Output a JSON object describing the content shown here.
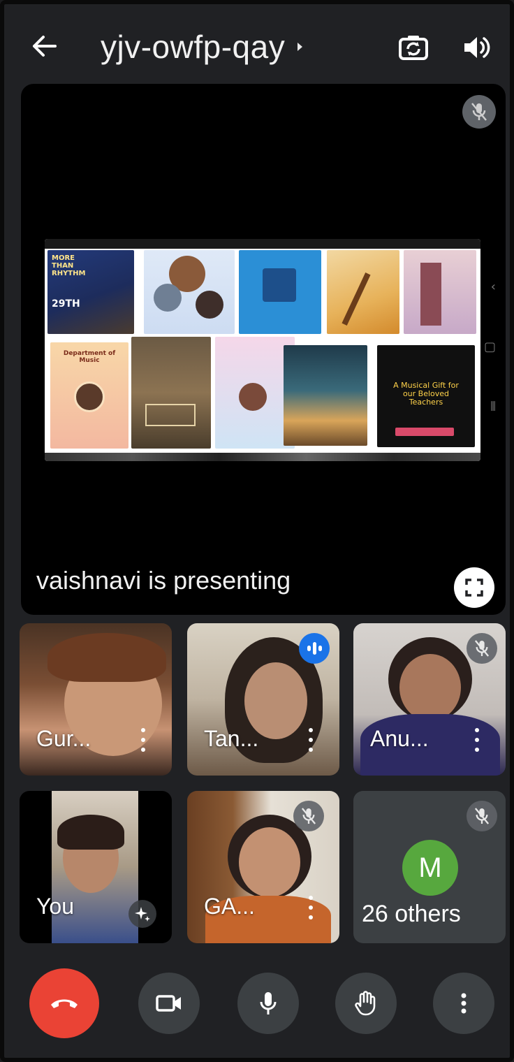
{
  "header": {
    "meeting_code": "yjv-owfp-qay",
    "back_icon": "arrow-left-icon",
    "switch_camera_icon": "switch-camera-icon",
    "audio_output_icon": "speaker-icon"
  },
  "presentation": {
    "label": "vaishnavi is presenting",
    "presenter_muted_icon": "mic-off-icon",
    "fullscreen_icon": "fullscreen-icon",
    "shared_content": {
      "poster_1": "MORE THAN RHYTHM",
      "poster_1_date": "29TH",
      "poster_2": "Department of Music",
      "poster_3": "A Musical Gift for our Beloved Teachers"
    }
  },
  "participants": [
    {
      "name": "Gur...",
      "muted": false
    },
    {
      "name": "Tan...",
      "speaking": true
    },
    {
      "name": "Anu...",
      "muted": true
    },
    {
      "name": "You",
      "effects_icon": "sparkle-icon"
    },
    {
      "name": "GA...",
      "muted": true
    },
    {
      "avatar_initial": "M",
      "avatar_color": "#57a83e",
      "label": "26 others",
      "muted": true
    }
  ],
  "controls": {
    "end_call_icon": "end-call-icon",
    "camera_icon": "camera-icon",
    "mic_icon": "mic-icon",
    "raise_hand_icon": "raise-hand-icon",
    "more_icon": "more-vertical-icon"
  },
  "colors": {
    "background": "#202124",
    "end_call": "#ea4335",
    "speaking": "#1a73e8",
    "control_bg": "#3c4043"
  }
}
